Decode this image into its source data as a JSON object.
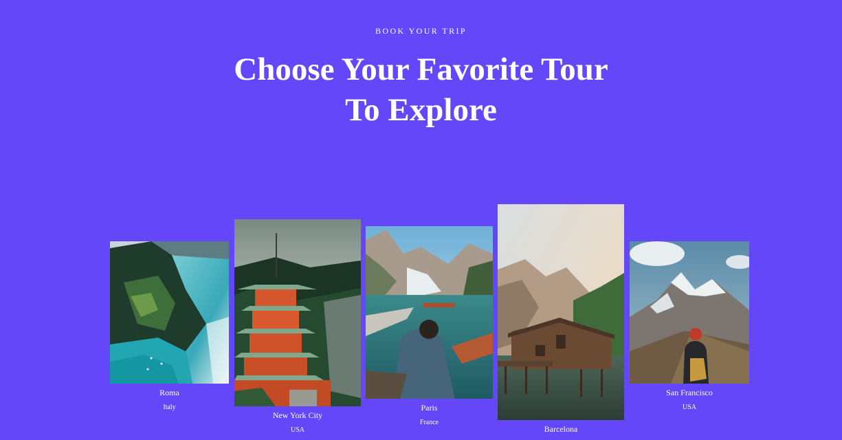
{
  "header": {
    "eyebrow": "BOOK YOUR TRIP",
    "title_line1": "Choose Your Favorite Tour",
    "title_line2": "To Explore"
  },
  "tours": [
    {
      "city": "Roma",
      "country": "Italy"
    },
    {
      "city": "New York City",
      "country": "USA"
    },
    {
      "city": "Paris",
      "country": "France"
    },
    {
      "city": "Barcelona",
      "country": ""
    },
    {
      "city": "San Francisco",
      "country": "USA"
    }
  ],
  "colors": {
    "background": "#6347f9",
    "text": "#ffffff"
  }
}
